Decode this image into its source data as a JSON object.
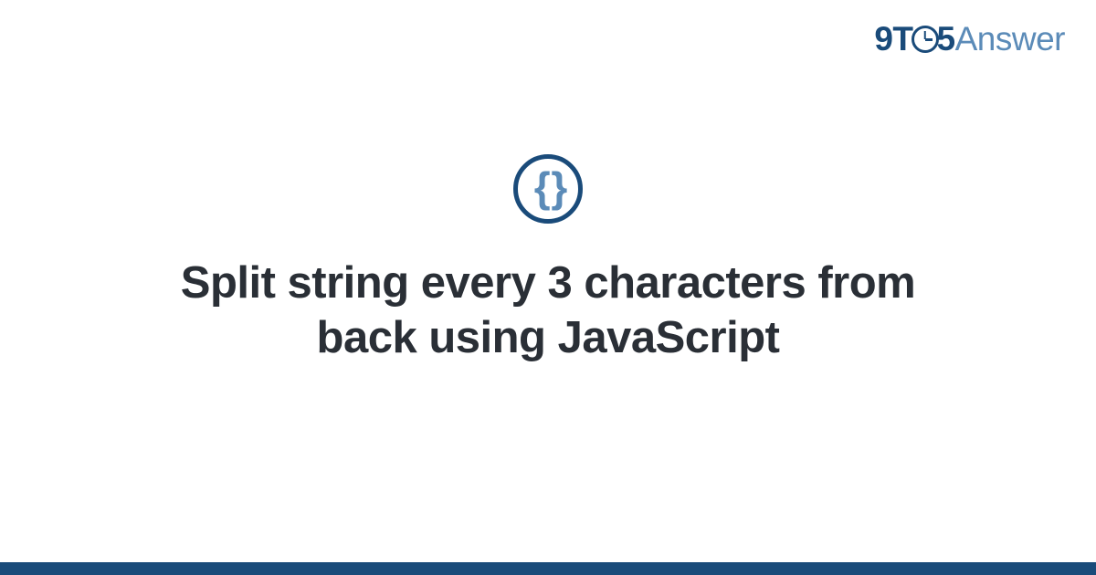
{
  "brand": {
    "prefix": "9T",
    "middle": "5",
    "suffix": "Answer"
  },
  "category": {
    "icon_name": "code-braces-icon",
    "symbol": "{ }"
  },
  "main": {
    "title": "Split string every 3 characters from back using JavaScript"
  },
  "colors": {
    "primary": "#1a4b7a",
    "secondary": "#5b8bb8",
    "text": "#2a2f36"
  }
}
